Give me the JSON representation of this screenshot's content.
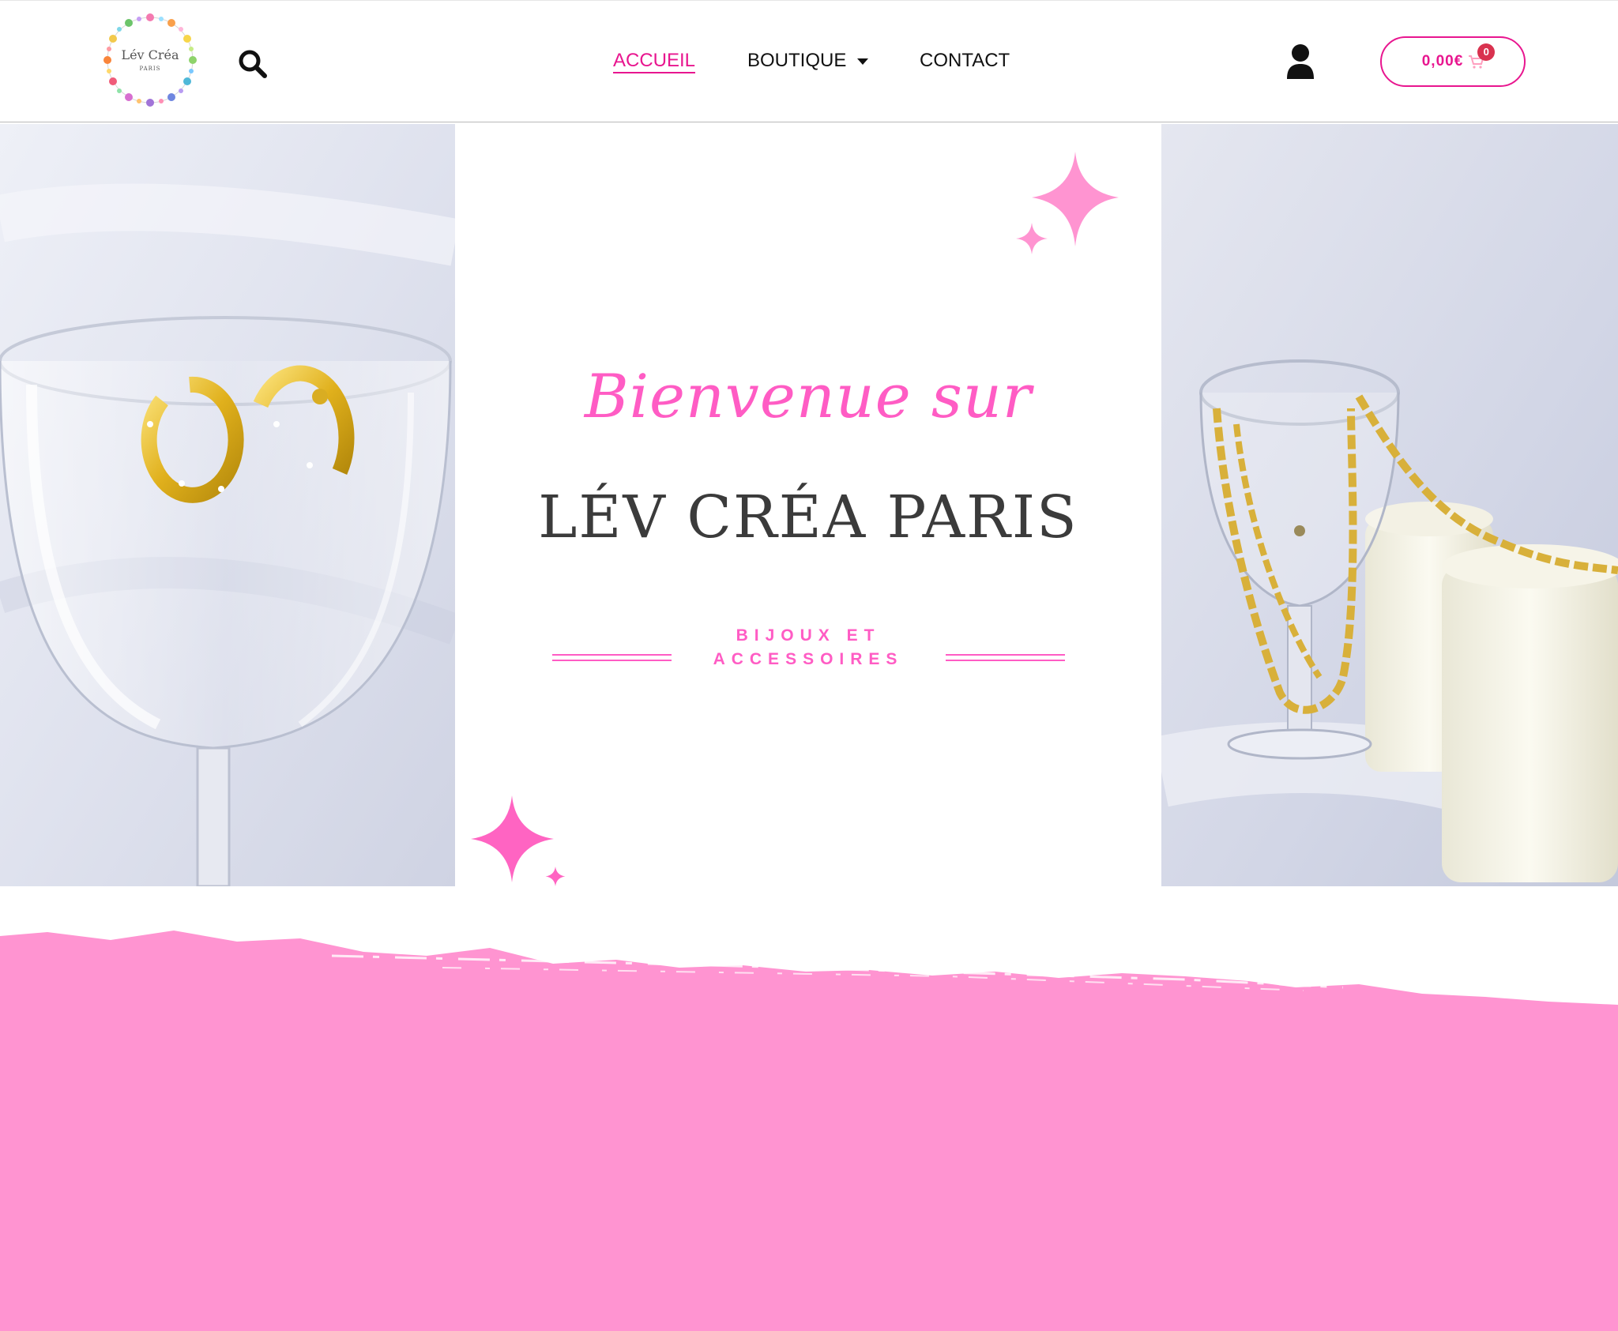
{
  "brand": {
    "logo_line1": "Lév Créa",
    "logo_line2": "PARIS"
  },
  "nav": {
    "items": [
      {
        "label": "ACCUEIL",
        "active": true
      },
      {
        "label": "BOUTIQUE",
        "dropdown": true
      },
      {
        "label": "CONTACT"
      }
    ]
  },
  "cart": {
    "total": "0,00€",
    "count": "0"
  },
  "hero": {
    "welcome": "Bienvenue sur",
    "title": "LÉV CRÉA PARIS",
    "tagline_line1": "BIJOUX ET",
    "tagline_line2": "ACCESSOIRES"
  },
  "icons": {
    "search": "search-icon",
    "account": "user-icon",
    "cart": "cart-icon",
    "dropdown": "caret-down-icon",
    "sparkle": "sparkle-icon"
  },
  "colors": {
    "accent_pink": "#e8168f",
    "soft_pink": "#ff5cc4",
    "brush_pink": "#ff94d1",
    "title_gray": "#3b3b3b"
  }
}
